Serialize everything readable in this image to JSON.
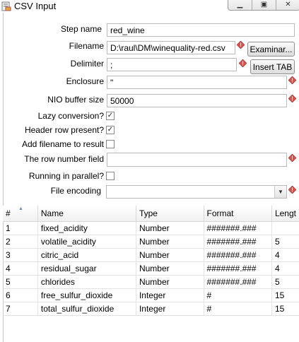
{
  "window": {
    "title": "CSV Input"
  },
  "fields": {
    "step_name_label": "Step name",
    "step_name_value": "red_wine",
    "filename_label": "Filename",
    "filename_value": "D:\\raul\\DM\\winequality-red.csv",
    "browse_label": "Examinar...",
    "delimiter_label": "Delimiter",
    "delimiter_value": ";",
    "insert_tab_label": "Insert TAB",
    "enclosure_label": "Enclosure",
    "enclosure_value": "\"",
    "nio_label": "NIO buffer size",
    "nio_value": "50000",
    "lazy_label": "Lazy conversion?",
    "lazy_checked": true,
    "header_label": "Header row present?",
    "header_checked": true,
    "add_filename_label": "Add filename to result",
    "add_filename_checked": false,
    "row_number_label": "The row number field",
    "row_number_value": "",
    "parallel_label": "Running in parallel?",
    "parallel_checked": false,
    "encoding_label": "File encoding",
    "encoding_value": ""
  },
  "table": {
    "columns": [
      "#",
      "Name",
      "Type",
      "Format",
      "Lengt"
    ],
    "rows": [
      [
        "1",
        "fixed_acidity",
        "Number",
        "#######.###",
        ""
      ],
      [
        "2",
        "volatile_acidity",
        "Number",
        "#######.###",
        "5"
      ],
      [
        "3",
        "citric_acid",
        "Number",
        "#######.###",
        "4"
      ],
      [
        "4",
        "residual_sugar",
        "Number",
        "#######.###",
        "4"
      ],
      [
        "5",
        "chlorides",
        "Number",
        "#######.###",
        "5"
      ],
      [
        "6",
        "free_sulfur_dioxide",
        "Integer",
        "#",
        "15"
      ],
      [
        "7",
        "total_sulfur_dioxide",
        "Integer",
        "#",
        "15"
      ]
    ]
  },
  "colors": {
    "warning": "#d9534f",
    "accent": "#c8ddf2"
  },
  "icons": {
    "app": "csv-input-icon",
    "warning": "warning-diamond-icon"
  }
}
